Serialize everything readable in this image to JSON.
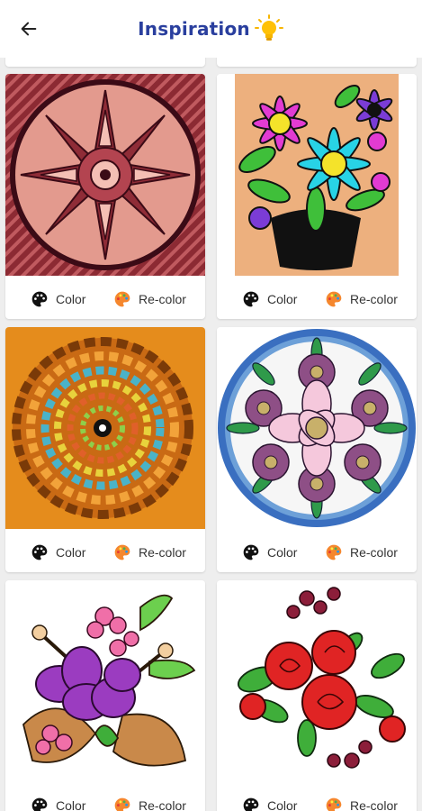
{
  "app_bar": {
    "title": "Inspiration",
    "back_icon": "arrow-left-icon",
    "title_icon": "lightbulb-icon"
  },
  "actions": {
    "color_label": "Color",
    "recolor_label": "Re-color",
    "color_icon": "palette-icon",
    "recolor_icon": "palette-color-icon"
  },
  "cards": [
    {
      "artwork": "pink-mandala"
    },
    {
      "artwork": "flower-vase"
    },
    {
      "artwork": "orange-spiral-mosaic"
    },
    {
      "artwork": "floral-mandala-circle"
    },
    {
      "artwork": "hibiscus-leaves"
    },
    {
      "artwork": "red-roses"
    }
  ],
  "colors": {
    "title": "#2a3f9e",
    "background": "#eeeeee",
    "card": "#ffffff"
  }
}
